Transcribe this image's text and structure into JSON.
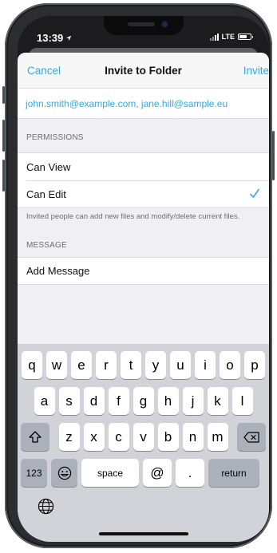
{
  "status_bar": {
    "time": "13:39",
    "network": "LTE"
  },
  "nav": {
    "cancel": "Cancel",
    "title": "Invite to Folder",
    "invite": "Invite"
  },
  "recipients": "john.smith@example.com, jane.hill@sample.eu",
  "permissions": {
    "header": "PERMISSIONS",
    "options": [
      {
        "label": "Can View",
        "selected": false
      },
      {
        "label": "Can Edit",
        "selected": true
      }
    ],
    "footer": "Invited people can add new files and modify/delete current files."
  },
  "message": {
    "header": "MESSAGE",
    "placeholder": "Add Message"
  },
  "keyboard": {
    "row1": [
      "q",
      "w",
      "e",
      "r",
      "t",
      "y",
      "u",
      "i",
      "o",
      "p"
    ],
    "row2": [
      "a",
      "s",
      "d",
      "f",
      "g",
      "h",
      "j",
      "k",
      "l"
    ],
    "row3": [
      "z",
      "x",
      "c",
      "v",
      "b",
      "n",
      "m"
    ],
    "numbers": "123",
    "space": "space",
    "at": "@",
    "dot": ".",
    "return": "return"
  },
  "colors": {
    "accent": "#34aadc",
    "grouped_bg": "#efeff4",
    "keyboard_bg": "#d1d3d9"
  }
}
